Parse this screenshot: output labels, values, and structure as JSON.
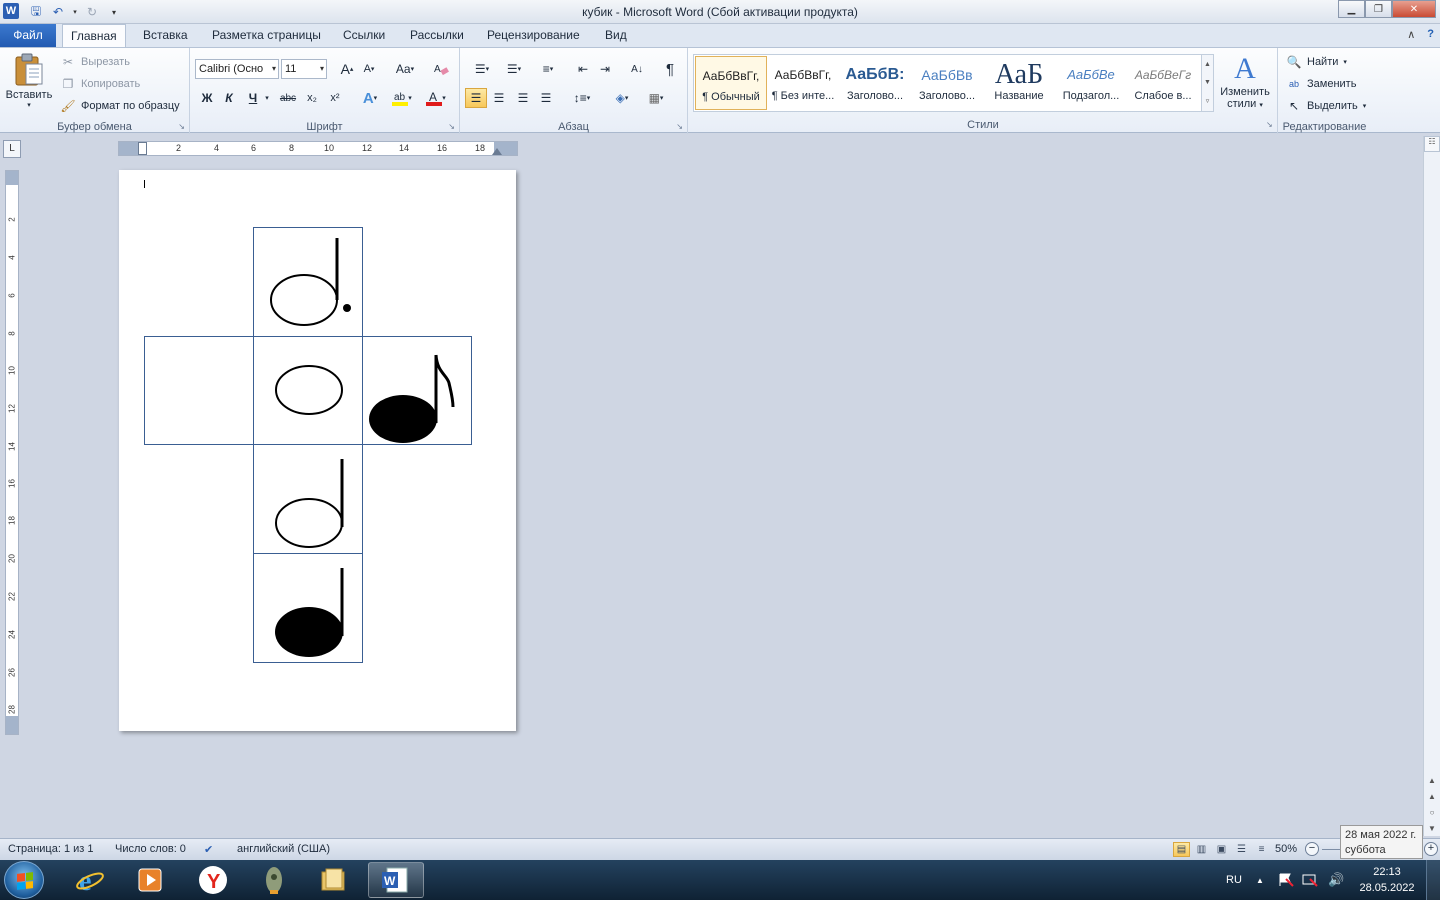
{
  "window": {
    "title": "кубик  -  Microsoft Word (Сбой активации продукта)",
    "app_icon": "W"
  },
  "qat": {
    "icons": [
      "save-icon",
      "undo-icon",
      "redo-icon",
      "customize-icon"
    ]
  },
  "tabs": {
    "file": "Файл",
    "items": [
      "Главная",
      "Вставка",
      "Разметка страницы",
      "Ссылки",
      "Рассылки",
      "Рецензирование",
      "Вид"
    ],
    "active": "Главная"
  },
  "clipboard": {
    "paste": "Вставить",
    "cut": "Вырезать",
    "copy": "Копировать",
    "format_painter": "Формат по образцу",
    "label": "Буфер обмена"
  },
  "font": {
    "family": "Calibri (Осно",
    "size": "11",
    "grow": "A",
    "shrink": "A",
    "case": "Aa",
    "bold": "Ж",
    "italic": "К",
    "underline": "Ч",
    "strike": "abc",
    "subscript": "x₂",
    "superscript": "x²",
    "label": "Шрифт"
  },
  "paragraph": {
    "label": "Абзац",
    "pilcrow": "¶"
  },
  "styles": {
    "items": [
      {
        "sample": "АаБбВвГг,",
        "name": "¶ Обычный"
      },
      {
        "sample": "АаБбВвГг,",
        "name": "¶ Без инте..."
      },
      {
        "sample": "АаБбВ:",
        "name": "Заголово..."
      },
      {
        "sample": "АаБбВв",
        "name": "Заголово..."
      },
      {
        "sample": "АаБ",
        "name": "Название"
      },
      {
        "sample": "АаБбВе",
        "name": "Подзагол..."
      },
      {
        "sample": "АаБбВеГг",
        "name": "Слабое в..."
      }
    ],
    "change": "Изменить стили",
    "change_line1": "Изменить",
    "change_line2": "стили",
    "label": "Стили"
  },
  "editing": {
    "find": "Найти",
    "replace": "Заменить",
    "select": "Выделить",
    "label": "Редактирование"
  },
  "ruler": {
    "h_numbers": [
      "2",
      "4",
      "6",
      "8",
      "10",
      "12",
      "14",
      "16",
      "18"
    ],
    "v_numbers": [
      "2",
      "4",
      "6",
      "8",
      "10",
      "12",
      "14",
      "16",
      "18",
      "20",
      "22",
      "24",
      "26",
      "28"
    ],
    "corner": "L"
  },
  "document": {
    "cube_faces": [
      {
        "id": "top",
        "note": "dotted-half-note"
      },
      {
        "id": "left",
        "note": "empty"
      },
      {
        "id": "center",
        "note": "whole-note"
      },
      {
        "id": "right",
        "note": "eighth-note"
      },
      {
        "id": "lower1",
        "note": "half-note"
      },
      {
        "id": "lower2",
        "note": "quarter-note"
      }
    ]
  },
  "status": {
    "page": "Страница: 1 из 1",
    "words": "Число слов: 0",
    "language": "английский (США)",
    "zoom": "50%"
  },
  "tooltip": {
    "line1": "28 мая 2022 г.",
    "line2": "суббота"
  },
  "taskbar": {
    "lang": "RU",
    "time": "22:13",
    "date": "28.05.2022",
    "apps": [
      "ie-icon",
      "media-player-icon",
      "yandex-icon",
      "rocket-icon",
      "explorer-icon",
      "word-icon"
    ]
  },
  "colors": {
    "accent": "#2b5fb3",
    "cell_border": "#3a5e92",
    "selection": "#f7c75a"
  }
}
